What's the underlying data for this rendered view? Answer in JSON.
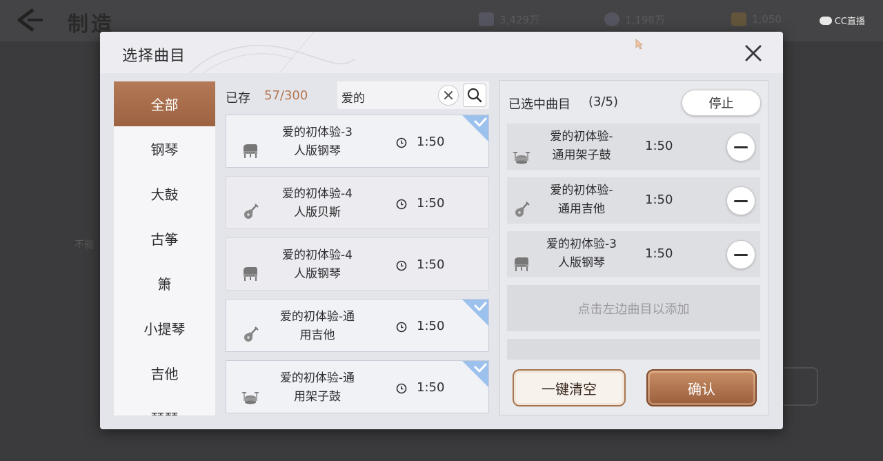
{
  "background": {
    "title": "制造",
    "resources": [
      {
        "icon": "crystal-icon",
        "value": "3,429万"
      },
      {
        "icon": "coin-icon",
        "value": "1,198万"
      },
      {
        "icon": "badge-icon",
        "value": "1,050"
      }
    ],
    "watermark": "CC直播",
    "side_text": "不能"
  },
  "modal": {
    "title": "选择曲目",
    "categories": [
      {
        "label": "全部",
        "active": true
      },
      {
        "label": "钢琴",
        "active": false
      },
      {
        "label": "大鼓",
        "active": false
      },
      {
        "label": "古筝",
        "active": false
      },
      {
        "label": "箫",
        "active": false
      },
      {
        "label": "小提琴",
        "active": false
      },
      {
        "label": "吉他",
        "active": false
      },
      {
        "label": "琵琶",
        "active": false
      }
    ],
    "stored_label": "已存",
    "stored_count": "57/300",
    "search": {
      "value": "爱的"
    },
    "songs": [
      {
        "line1": "爱的初体验-3",
        "line2": "人版钢琴",
        "duration": "1:50",
        "instrument": "piano-icon",
        "selected": true
      },
      {
        "line1": "爱的初体验-4",
        "line2": "人版贝斯",
        "duration": "1:50",
        "instrument": "guitar-icon",
        "selected": false
      },
      {
        "line1": "爱的初体验-4",
        "line2": "人版钢琴",
        "duration": "1:50",
        "instrument": "piano-icon",
        "selected": false
      },
      {
        "line1": "爱的初体验-通",
        "line2": "用吉他",
        "duration": "1:50",
        "instrument": "guitar-icon",
        "selected": true
      },
      {
        "line1": "爱的初体验-通",
        "line2": "用架子鼓",
        "duration": "1:50",
        "instrument": "drum-icon",
        "selected": true
      }
    ],
    "selected_panel": {
      "label": "已选中曲目",
      "count": "(3/5)",
      "stop_label": "停止",
      "items": [
        {
          "line1": "爱的初体验-",
          "line2": "通用架子鼓",
          "duration": "1:50",
          "instrument": "drum-icon"
        },
        {
          "line1": "爱的初体验-",
          "line2": "通用吉他",
          "duration": "1:50",
          "instrument": "guitar-icon"
        },
        {
          "line1": "爱的初体验-3",
          "line2": "人版钢琴",
          "duration": "1:50",
          "instrument": "piano-icon"
        }
      ],
      "empty_slot_label": "点击左边曲目以添加",
      "clear_label": "一键清空",
      "confirm_label": "确认"
    }
  }
}
